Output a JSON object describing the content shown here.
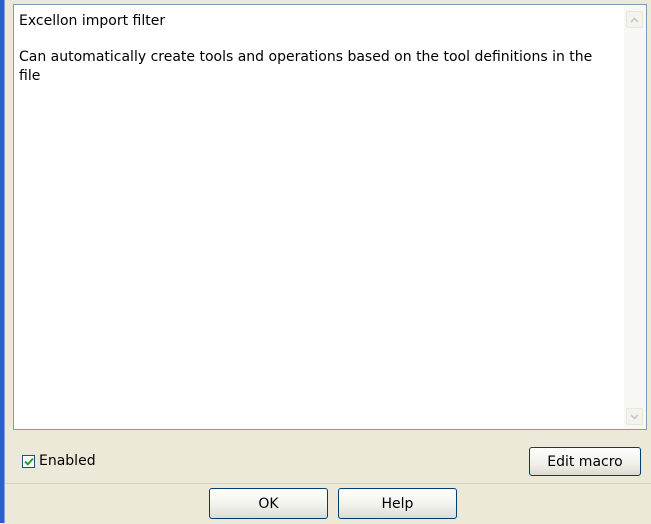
{
  "description": {
    "title": "Excellon import filter",
    "body": "Can automatically create tools and operations based on the tool definitions in the file"
  },
  "scrollbar": {
    "up_icon": "scroll-up-arrow",
    "down_icon": "scroll-down-arrow"
  },
  "enabled": {
    "label": "Enabled",
    "checked": true
  },
  "buttons": {
    "edit_macro": "Edit macro",
    "ok": "OK",
    "help": "Help"
  },
  "colors": {
    "dialog_background": "#ece9d8",
    "panel_border": "#7f9db9",
    "button_border": "#003c74",
    "check_mark": "#21a121",
    "window_edge": "#2b5fcf"
  }
}
